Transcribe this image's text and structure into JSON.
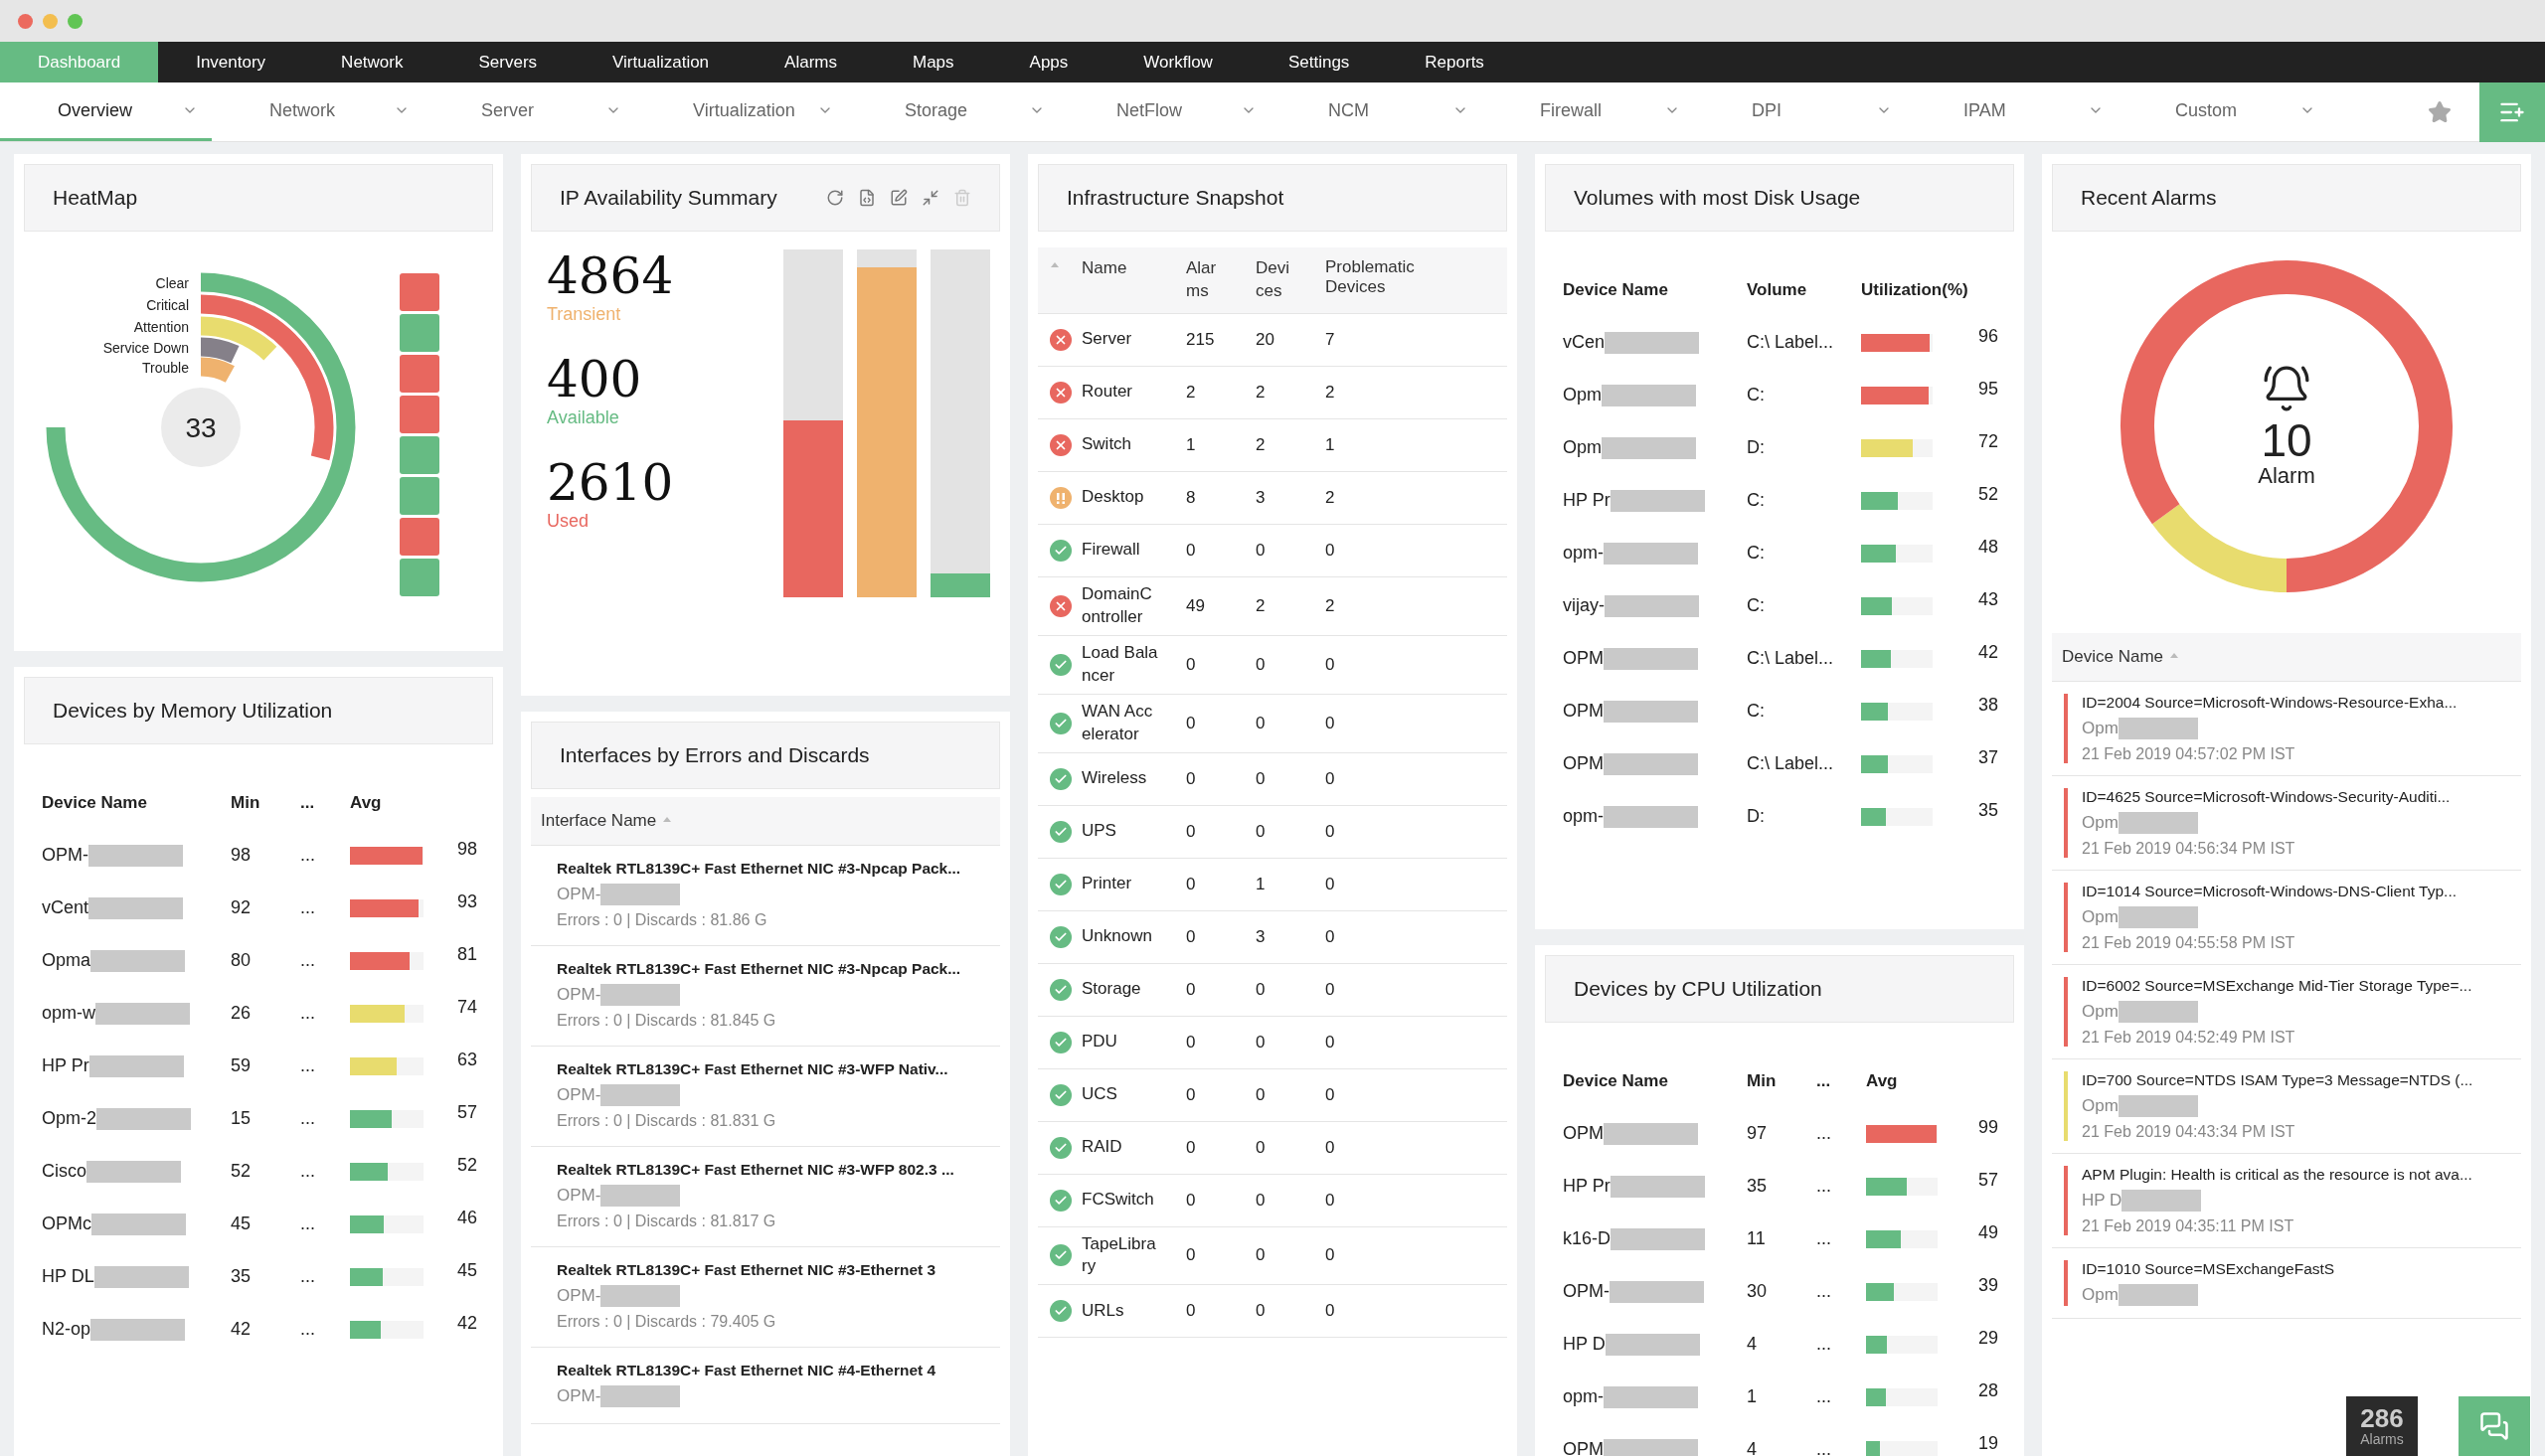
{
  "main_nav": [
    {
      "label": "Dashboard",
      "selected": true
    },
    {
      "label": "Inventory",
      "selected": false
    },
    {
      "label": "Network",
      "selected": false
    },
    {
      "label": "Servers",
      "selected": false
    },
    {
      "label": "Virtualization",
      "selected": false
    },
    {
      "label": "Alarms",
      "selected": false
    },
    {
      "label": "Maps",
      "selected": false
    },
    {
      "label": "Apps",
      "selected": false
    },
    {
      "label": "Workflow",
      "selected": false
    },
    {
      "label": "Settings",
      "selected": false
    },
    {
      "label": "Reports",
      "selected": false
    }
  ],
  "sub_nav": [
    {
      "label": "Overview",
      "selected": true
    },
    {
      "label": "Network",
      "selected": false
    },
    {
      "label": "Server",
      "selected": false
    },
    {
      "label": "Virtualization",
      "selected": false
    },
    {
      "label": "Storage",
      "selected": false
    },
    {
      "label": "NetFlow",
      "selected": false
    },
    {
      "label": "NCM",
      "selected": false
    },
    {
      "label": "Firewall",
      "selected": false
    },
    {
      "label": "DPI",
      "selected": false
    },
    {
      "label": "IPAM",
      "selected": false
    },
    {
      "label": "Custom",
      "selected": false
    }
  ],
  "heatmap": {
    "title": "HeatMap",
    "total": "33",
    "arcs": [
      {
        "label": "Clear"
      },
      {
        "label": "Critical"
      },
      {
        "label": "Attention"
      },
      {
        "label": "Service Down"
      },
      {
        "label": "Trouble"
      }
    ],
    "squares": [
      {
        "color": "#e8675f"
      },
      {
        "color": "#66bb83"
      },
      {
        "color": "#e8675f"
      },
      {
        "color": "#e8675f"
      },
      {
        "color": "#66bb83"
      },
      {
        "color": "#66bb83"
      },
      {
        "color": "#e8675f"
      },
      {
        "color": "#66bb83"
      }
    ]
  },
  "ip_summary": {
    "title": "IP Availability Summary",
    "stats": [
      {
        "value": "4864",
        "label": "Transient",
        "color": "#efb26e",
        "level": 0.95
      },
      {
        "value": "400",
        "label": "Available",
        "color": "#66bb83",
        "level": 0.07
      },
      {
        "value": "2610",
        "label": "Used",
        "color": "#e8675f",
        "level": 0.51
      }
    ]
  },
  "memory": {
    "title": "Devices by Memory Utilization",
    "columns": [
      "Device Name",
      "Min",
      "...",
      "Avg"
    ],
    "rows": [
      {
        "name": "OPM-",
        "min": "98",
        "more": "...",
        "avg": "98",
        "level": 0.98,
        "color": "#e8675f"
      },
      {
        "name": "vCent",
        "min": "92",
        "more": "...",
        "avg": "93",
        "level": 0.93,
        "color": "#e8675f"
      },
      {
        "name": "Opma",
        "min": "80",
        "more": "...",
        "avg": "81",
        "level": 0.81,
        "color": "#e8675f"
      },
      {
        "name": "opm-w",
        "min": "26",
        "more": "...",
        "avg": "74",
        "level": 0.74,
        "color": "#e8dc6e"
      },
      {
        "name": "HP Pr",
        "min": "59",
        "more": "...",
        "avg": "63",
        "level": 0.63,
        "color": "#e8dc6e"
      },
      {
        "name": "Opm-2",
        "min": "15",
        "more": "...",
        "avg": "57",
        "level": 0.57,
        "color": "#66bb83"
      },
      {
        "name": "Cisco",
        "min": "52",
        "more": "...",
        "avg": "52",
        "level": 0.52,
        "color": "#66bb83"
      },
      {
        "name": "OPMc",
        "min": "45",
        "more": "...",
        "avg": "46",
        "level": 0.46,
        "color": "#66bb83"
      },
      {
        "name": "HP DL",
        "min": "35",
        "more": "...",
        "avg": "45",
        "level": 0.45,
        "color": "#66bb83"
      },
      {
        "name": "N2-op",
        "min": "42",
        "more": "...",
        "avg": "42",
        "level": 0.42,
        "color": "#66bb83"
      }
    ]
  },
  "interfaces": {
    "title": "Interfaces by Errors and Discards",
    "column": "Interface Name",
    "items": [
      {
        "name": "Realtek RTL8139C+ Fast Ethernet NIC #3-Npcap Pack...",
        "device": "OPM-",
        "stats": "Errors : 0 | Discards : 81.86 G"
      },
      {
        "name": "Realtek RTL8139C+ Fast Ethernet NIC #3-Npcap Pack...",
        "device": "OPM-",
        "stats": "Errors : 0 | Discards : 81.845 G"
      },
      {
        "name": "Realtek RTL8139C+ Fast Ethernet NIC #3-WFP Nativ...",
        "device": "OPM-",
        "stats": "Errors : 0 | Discards : 81.831 G"
      },
      {
        "name": "Realtek RTL8139C+ Fast Ethernet NIC #3-WFP 802.3 ...",
        "device": "OPM-",
        "stats": "Errors : 0 | Discards : 81.817 G"
      },
      {
        "name": "Realtek RTL8139C+ Fast Ethernet NIC #3-Ethernet 3",
        "device": "OPM-",
        "stats": "Errors : 0 | Discards : 79.405 G"
      },
      {
        "name": "Realtek RTL8139C+ Fast Ethernet NIC #4-Ethernet 4",
        "device": "OPM-"
      }
    ]
  },
  "infrastructure": {
    "title": "Infrastructure Snapshot",
    "columns": [
      "Name",
      "Alarms",
      "Devices",
      "Problematic Devices"
    ],
    "rows": [
      {
        "kind": "critical",
        "name": "Server",
        "alarms": "215",
        "devices": "20",
        "problematic": "7"
      },
      {
        "kind": "critical",
        "name": "Router",
        "alarms": "2",
        "devices": "2",
        "problematic": "2"
      },
      {
        "kind": "critical",
        "name": "Switch",
        "alarms": "1",
        "devices": "2",
        "problematic": "1"
      },
      {
        "kind": "warning",
        "name": "Desktop",
        "alarms": "8",
        "devices": "3",
        "problematic": "2"
      },
      {
        "kind": "ok",
        "name": "Firewall",
        "alarms": "0",
        "devices": "0",
        "problematic": "0"
      },
      {
        "kind": "critical",
        "name": "DomainController",
        "alarms": "49",
        "devices": "2",
        "problematic": "2"
      },
      {
        "kind": "ok",
        "name": "Load Balancer",
        "alarms": "0",
        "devices": "0",
        "problematic": "0"
      },
      {
        "kind": "ok",
        "name": "WAN Accelerator",
        "alarms": "0",
        "devices": "0",
        "problematic": "0"
      },
      {
        "kind": "ok",
        "name": "Wireless",
        "alarms": "0",
        "devices": "0",
        "problematic": "0"
      },
      {
        "kind": "ok",
        "name": "UPS",
        "alarms": "0",
        "devices": "0",
        "problematic": "0"
      },
      {
        "kind": "ok",
        "name": "Printer",
        "alarms": "0",
        "devices": "1",
        "problematic": "0"
      },
      {
        "kind": "ok",
        "name": "Unknown",
        "alarms": "0",
        "devices": "3",
        "problematic": "0"
      },
      {
        "kind": "ok",
        "name": "Storage",
        "alarms": "0",
        "devices": "0",
        "problematic": "0"
      },
      {
        "kind": "ok",
        "name": "PDU",
        "alarms": "0",
        "devices": "0",
        "problematic": "0"
      },
      {
        "kind": "ok",
        "name": "UCS",
        "alarms": "0",
        "devices": "0",
        "problematic": "0"
      },
      {
        "kind": "ok",
        "name": "RAID",
        "alarms": "0",
        "devices": "0",
        "problematic": "0"
      },
      {
        "kind": "ok",
        "name": "FCSwitch",
        "alarms": "0",
        "devices": "0",
        "problematic": "0"
      },
      {
        "kind": "ok",
        "name": "TapeLibrary",
        "alarms": "0",
        "devices": "0",
        "problematic": "0"
      },
      {
        "kind": "ok",
        "name": "URLs",
        "alarms": "0",
        "devices": "0",
        "problematic": "0"
      }
    ]
  },
  "volumes": {
    "title": "Volumes with most Disk Usage",
    "columns": [
      "Device Name",
      "Volume",
      "Utilization(%)"
    ],
    "rows": [
      {
        "name": "vCen",
        "volume": "C:\\ Label...",
        "value": "96",
        "level": 0.96,
        "color": "#e8675f"
      },
      {
        "name": "Opm",
        "volume": "C:",
        "value": "95",
        "level": 0.95,
        "color": "#e8675f"
      },
      {
        "name": "Opm",
        "volume": "D:",
        "value": "72",
        "level": 0.72,
        "color": "#e8dc6e"
      },
      {
        "name": "HP Pr",
        "volume": "C:",
        "value": "52",
        "level": 0.52,
        "color": "#66bb83"
      },
      {
        "name": "opm-",
        "volume": "C:",
        "value": "48",
        "level": 0.48,
        "color": "#66bb83"
      },
      {
        "name": "vijay-",
        "volume": "C:",
        "value": "43",
        "level": 0.43,
        "color": "#66bb83"
      },
      {
        "name": "OPM",
        "volume": "C:\\ Label...",
        "value": "42",
        "level": 0.42,
        "color": "#66bb83"
      },
      {
        "name": "OPM",
        "volume": "C:",
        "value": "38",
        "level": 0.38,
        "color": "#66bb83"
      },
      {
        "name": "OPM",
        "volume": "C:\\ Label...",
        "value": "37",
        "level": 0.37,
        "color": "#66bb83"
      },
      {
        "name": "opm-",
        "volume": "D:",
        "value": "35",
        "level": 0.35,
        "color": "#66bb83"
      }
    ]
  },
  "cpu": {
    "title": "Devices by CPU Utilization",
    "columns": [
      "Device Name",
      "Min",
      "...",
      "Avg"
    ],
    "rows": [
      {
        "name": "OPM",
        "min": "97",
        "more": "...",
        "avg": "99",
        "level": 0.99,
        "color": "#e8675f"
      },
      {
        "name": "HP Pr",
        "min": "35",
        "more": "...",
        "avg": "57",
        "level": 0.57,
        "color": "#66bb83"
      },
      {
        "name": "k16-D",
        "min": "11",
        "more": "...",
        "avg": "49",
        "level": 0.49,
        "color": "#66bb83"
      },
      {
        "name": "OPM-",
        "min": "30",
        "more": "...",
        "avg": "39",
        "level": 0.39,
        "color": "#66bb83"
      },
      {
        "name": "HP D",
        "min": "4",
        "more": "...",
        "avg": "29",
        "level": 0.29,
        "color": "#66bb83"
      },
      {
        "name": "opm-",
        "min": "1",
        "more": "...",
        "avg": "28",
        "level": 0.28,
        "color": "#66bb83"
      },
      {
        "name": "OPM",
        "min": "4",
        "more": "...",
        "avg": "19",
        "level": 0.19,
        "color": "#66bb83"
      }
    ]
  },
  "recent_alarms": {
    "title": "Recent Alarms",
    "count": "10",
    "count_label": "Alarm",
    "column": "Device Name",
    "items": [
      {
        "message": "ID=2004 Source=Microsoft-Windows-Resource-Exha...",
        "device": "Opm",
        "time": "21 Feb 2019 04:57:02 PM IST",
        "color": "#e8675f"
      },
      {
        "message": "ID=4625 Source=Microsoft-Windows-Security-Auditi...",
        "device": "Opm",
        "time": "21 Feb 2019 04:56:34 PM IST",
        "color": "#e8675f"
      },
      {
        "message": "ID=1014 Source=Microsoft-Windows-DNS-Client Typ...",
        "device": "Opm",
        "time": "21 Feb 2019 04:55:58 PM IST",
        "color": "#e8675f"
      },
      {
        "message": "ID=6002 Source=MSExchange Mid-Tier Storage Type=...",
        "device": "Opm",
        "time": "21 Feb 2019 04:52:49 PM IST",
        "color": "#e8675f"
      },
      {
        "message": "ID=700 Source=NTDS ISAM Type=3 Message=NTDS (...",
        "device": "Opm",
        "time": "21 Feb 2019 04:43:34 PM IST",
        "color": "#e8dc6e"
      },
      {
        "message": "APM Plugin: Health is critical as the resource is not ava...",
        "device": "HP D",
        "time": "21 Feb 2019 04:35:11 PM IST",
        "color": "#e8675f"
      },
      {
        "message": "ID=1010 Source=MSExchangeFastS",
        "device": "Opm",
        "color": "#e8675f"
      }
    ]
  },
  "alarm_counter": {
    "count": "286",
    "label": "Alarms"
  }
}
